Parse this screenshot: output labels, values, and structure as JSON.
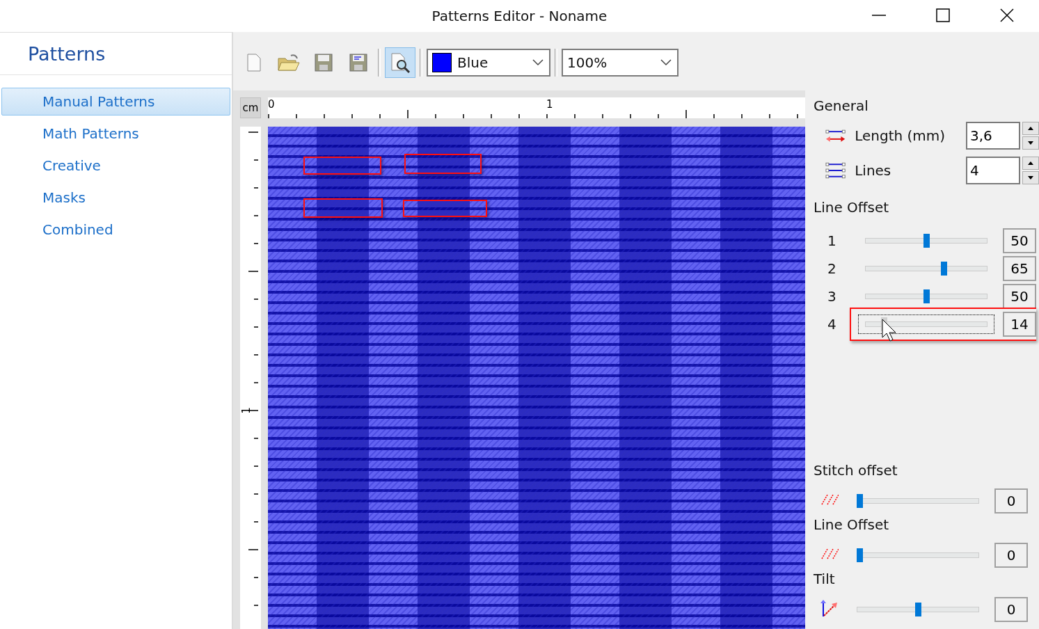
{
  "window": {
    "title": "Patterns Editor - Noname"
  },
  "sidebar": {
    "title": "Patterns",
    "items": [
      {
        "label": "Manual Patterns",
        "selected": true
      },
      {
        "label": "Math Patterns",
        "selected": false
      },
      {
        "label": "Creative",
        "selected": false
      },
      {
        "label": "Masks",
        "selected": false
      },
      {
        "label": "Combined",
        "selected": false
      }
    ]
  },
  "toolbar": {
    "preview_selected": true,
    "color_select": {
      "value": "Blue",
      "color": "#0000ff"
    },
    "zoom_select": {
      "value": "100%"
    }
  },
  "ruler": {
    "unit": "cm",
    "labels": [
      "0",
      "1"
    ],
    "vertical_labels": [
      "1"
    ]
  },
  "general": {
    "title": "General",
    "fields": [
      {
        "kind": "length",
        "label": "Length (mm)",
        "value": "3,6"
      },
      {
        "kind": "lines",
        "label": "Lines",
        "value": "4"
      }
    ]
  },
  "line_offset": {
    "title": "Line Offset",
    "rows": [
      {
        "label": "1",
        "level": 0.5,
        "value": "50",
        "focused": false,
        "highlighted": false
      },
      {
        "label": "2",
        "level": 0.65,
        "value": "65",
        "focused": false,
        "highlighted": false
      },
      {
        "label": "3",
        "level": 0.5,
        "value": "50",
        "focused": false,
        "highlighted": false
      },
      {
        "label": "4",
        "level": 0.14,
        "value": "14",
        "focused": true,
        "highlighted": true
      }
    ]
  },
  "adjustments": [
    {
      "kind": "stitch",
      "title": "Stitch offset",
      "level": 0,
      "value": "0"
    },
    {
      "kind": "stitch",
      "title": "Line Offset",
      "level": 0,
      "value": "0"
    },
    {
      "kind": "tilt",
      "title": "Tilt",
      "level": 0.5,
      "value": "0"
    }
  ]
}
